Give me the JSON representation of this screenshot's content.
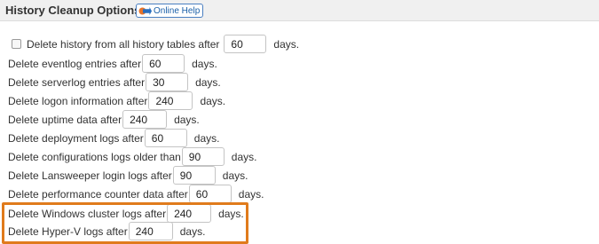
{
  "header": {
    "title": "History Cleanup Options",
    "help_label": "Online Help"
  },
  "settings": [
    {
      "label": "Delete history from all history tables after",
      "value": "60",
      "unit": "days."
    },
    {
      "label": "Delete eventlog entries after",
      "value": "60",
      "unit": "days."
    },
    {
      "label": "Delete serverlog entries after",
      "value": "30",
      "unit": "days."
    },
    {
      "label": "Delete logon information after",
      "value": "240",
      "unit": "days."
    },
    {
      "label": "Delete uptime data after",
      "value": "240",
      "unit": "days."
    },
    {
      "label": "Delete deployment logs after",
      "value": "60",
      "unit": "days."
    },
    {
      "label": "Delete configurations logs older than",
      "value": "90",
      "unit": "days."
    },
    {
      "label": "Delete Lansweeper login logs after",
      "value": "90",
      "unit": "days."
    },
    {
      "label": "Delete performance counter data after",
      "value": "60",
      "unit": "days."
    },
    {
      "label": "Delete Windows cluster logs after",
      "value": "240",
      "unit": "days."
    },
    {
      "label": "Delete Hyper-V logs after",
      "value": "240",
      "unit": "days."
    }
  ],
  "colors": {
    "highlight": "#e07b1c",
    "help_accent": "#1a5fa8",
    "header_bg": "#f0f0f0"
  }
}
